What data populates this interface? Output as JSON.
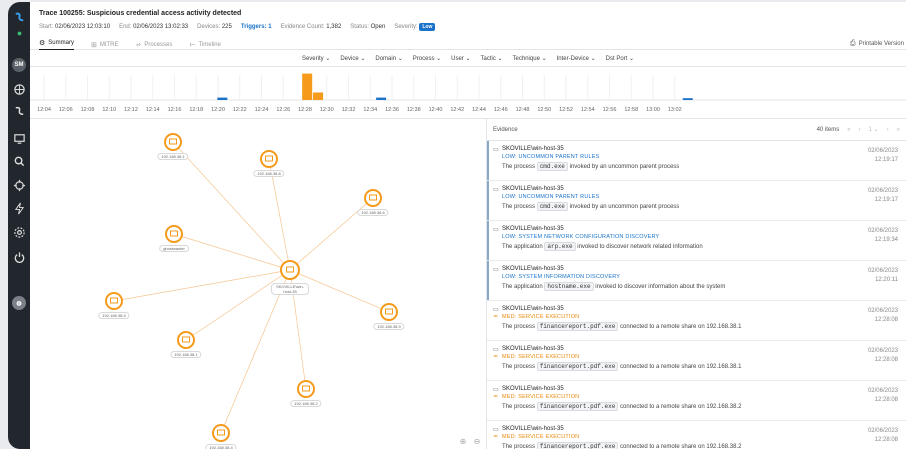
{
  "sidebar": {
    "avatar_top": "SM"
  },
  "header": {
    "title": "Trace 100255: Suspicious credential access activity detected",
    "start_label": "Start:",
    "start_value": "02/06/2023 12:03:10",
    "end_label": "End:",
    "end_value": "02/06/2023 13:02:33",
    "devices_label": "Devices:",
    "devices_value": "225",
    "triggers_label": "Triggers:",
    "triggers_value": "1",
    "evidence_label": "Evidence Count:",
    "evidence_value": "1,382",
    "status_label": "Status:",
    "status_value": "Open",
    "severity_label": "Severity:",
    "severity_value": "Low",
    "printable": "Printable Version",
    "tabs": [
      {
        "label": "Summary",
        "icon": "gear-icon",
        "glyph": "⚙"
      },
      {
        "label": "MITRE",
        "icon": "grid-icon",
        "glyph": "⊞"
      },
      {
        "label": "Processes",
        "icon": "hierarchy-icon",
        "glyph": "⩫"
      },
      {
        "label": "Timeline",
        "icon": "timeline-icon",
        "glyph": "⊢"
      }
    ]
  },
  "filters": [
    "Severity ⌄",
    "Device ⌄",
    "Domain ⌄",
    "Process ⌄",
    "User ⌄",
    "Tactic ⌄",
    "Technique ⌄",
    "Inter-Device ⌄",
    "Dst Port ⌄"
  ],
  "timeline": {
    "ticks": [
      "12:04",
      "12:06",
      "12:08",
      "12:10",
      "12:12",
      "12:14",
      "12:16",
      "12:18",
      "12:20",
      "12:22",
      "12:24",
      "12:26",
      "12:28",
      "12:30",
      "12:32",
      "12:34",
      "12:36",
      "12:38",
      "12:40",
      "12:42",
      "12:44",
      "12:46",
      "12:48",
      "12:50",
      "12:52",
      "12:54",
      "12:56",
      "12:58",
      "13:00",
      "13:02"
    ],
    "bars": [
      {
        "tick_index": 8.2,
        "level": 0.08,
        "color": "#1a73c8"
      },
      {
        "tick_index": 12.1,
        "level": 0.88,
        "color": "#f59a1b"
      },
      {
        "tick_index": 12.6,
        "level": 0.25,
        "color": "#f59a1b"
      },
      {
        "tick_index": 15.5,
        "level": 0.08,
        "color": "#1a73c8"
      },
      {
        "tick_index": 29.6,
        "level": 0.06,
        "color": "#1a73c8"
      }
    ]
  },
  "graph": {
    "center": {
      "label": "SKOVILLE\\win-host-35"
    },
    "nodes": [
      {
        "label": "192.168.38.1"
      },
      {
        "label": "192.168.38.8"
      },
      {
        "label": "192.168.38.6"
      },
      {
        "label": "ghostwaster"
      },
      {
        "label": "192.168.38.5"
      },
      {
        "label": "192.168.38.9"
      },
      {
        "label": "192.168.38.1"
      },
      {
        "label": "192.168.38.2"
      },
      {
        "label": "192.168.38.4"
      }
    ]
  },
  "evidence": {
    "title": "Evidence",
    "items_count": "40 items",
    "pager": [
      "«",
      "‹",
      "1 ⌄",
      "›",
      "»"
    ],
    "items": [
      {
        "host": "SKOVILLE\\win-host-35",
        "severity": "LOW: UNCOMMON PARENT RULES",
        "sev": "low",
        "pre": "The process",
        "code": "cmd.exe",
        "post": "invoked by an uncommon parent process",
        "date": "02/06/2023",
        "time": "12:19:17"
      },
      {
        "host": "SKOVILLE\\win-host-35",
        "severity": "LOW: UNCOMMON PARENT RULES",
        "sev": "low",
        "pre": "The process",
        "code": "cmd.exe",
        "post": "invoked by an uncommon parent process",
        "date": "02/06/2023",
        "time": "12:19:17"
      },
      {
        "host": "SKOVILLE\\win-host-35",
        "severity": "LOW: SYSTEM NETWORK CONFIGURATION DISCOVERY",
        "sev": "low",
        "pre": "The application",
        "code": "arp.exe",
        "post": "invoked to discover network related information",
        "date": "02/06/2023",
        "time": "12:19:34"
      },
      {
        "host": "SKOVILLE\\win-host-35",
        "severity": "LOW: SYSTEM INFORMATION DISCOVERY",
        "sev": "low",
        "pre": "The application",
        "code": "hostname.exe",
        "post": "invoked to discover information about the system",
        "date": "02/06/2023",
        "time": "12:20:11"
      },
      {
        "host": "SKOVILLE\\win-host-35",
        "severity": "MED: SERVICE EXECUTION",
        "sev": "med",
        "pre": "The process",
        "code": "financereport.pdf.exe",
        "post": "connected to a remote share on 192.168.38.1",
        "date": "02/06/2023",
        "time": "12:28:08"
      },
      {
        "host": "SKOVILLE\\win-host-35",
        "severity": "MED: SERVICE EXECUTION",
        "sev": "med",
        "pre": "The process",
        "code": "financereport.pdf.exe",
        "post": "connected to a remote share on 192.168.38.1",
        "date": "02/06/2023",
        "time": "12:28:08"
      },
      {
        "host": "SKOVILLE\\win-host-35",
        "severity": "MED: SERVICE EXECUTION",
        "sev": "med",
        "pre": "The process",
        "code": "financereport.pdf.exe",
        "post": "connected to a remote share on 192.168.38.2",
        "date": "02/06/2023",
        "time": "12:28:08"
      },
      {
        "host": "SKOVILLE\\win-host-35",
        "severity": "MED: SERVICE EXECUTION",
        "sev": "med",
        "pre": "The process",
        "code": "financereport.pdf.exe",
        "post": "connected to a remote share on 192.168.38.2",
        "date": "02/06/2023",
        "time": "12:28:08"
      }
    ]
  },
  "colors": {
    "accent": "#1a73c8",
    "orange": "#f59a1b",
    "sidebar": "#22272d"
  }
}
